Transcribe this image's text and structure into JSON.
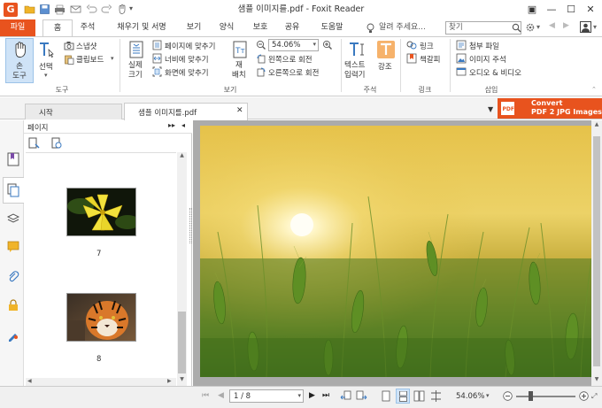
{
  "window": {
    "title": "샘플 이미지를.pdf - Foxit Reader",
    "logo_letter": "G"
  },
  "menu": {
    "tabs": [
      "파일",
      "홈",
      "주석",
      "채우기 및 서명",
      "보기",
      "양식",
      "보호",
      "공유",
      "도움말"
    ],
    "tell_me": "알려 주세요...",
    "search_placeholder": "찾기"
  },
  "ribbon": {
    "hand_tool": "손\n도구",
    "hand_tool_l1": "손",
    "hand_tool_l2": "도구",
    "select": "선택",
    "snapshot": "스냅샷",
    "clipboard": "클립보드",
    "actual_size_l1": "실제",
    "actual_size_l2": "크기",
    "fit_page": "페이지에 맞추기",
    "fit_width": "너비에 맞추기",
    "fit_visible": "화면에 맞추기",
    "reflow_l1": "재",
    "reflow_l2": "배치",
    "zoom_value": "54.06%",
    "rotate_left": "왼쪽으로 회전",
    "rotate_right": "오른쪽으로 회전",
    "typewriter_l1": "텍스트",
    "typewriter_l2": "입력기",
    "highlight": "강조",
    "link": "링크",
    "bookmark": "책갈피",
    "attach_file": "첨부 파일",
    "image_annotation": "이미지 주석",
    "audio_video": "오디오 & 비디오",
    "groups": [
      "도구",
      "보기",
      "주석",
      "링크",
      "삽입"
    ]
  },
  "doc_tabs": {
    "start": "시작",
    "file": "샘플 이미지를.pdf",
    "promo_l1": "Convert",
    "promo_l2": "PDF 2 JPG Images"
  },
  "pages_panel": {
    "title": "페이지",
    "thumbnails": [
      {
        "label": "7",
        "subject": "yellow lily flower"
      },
      {
        "label": "8",
        "subject": "tiger"
      }
    ]
  },
  "status": {
    "page_indicator": "1 / 8",
    "zoom": "54.06%"
  },
  "colors": {
    "accent": "#e8531e",
    "ribbon_active": "#cfe3f7"
  }
}
